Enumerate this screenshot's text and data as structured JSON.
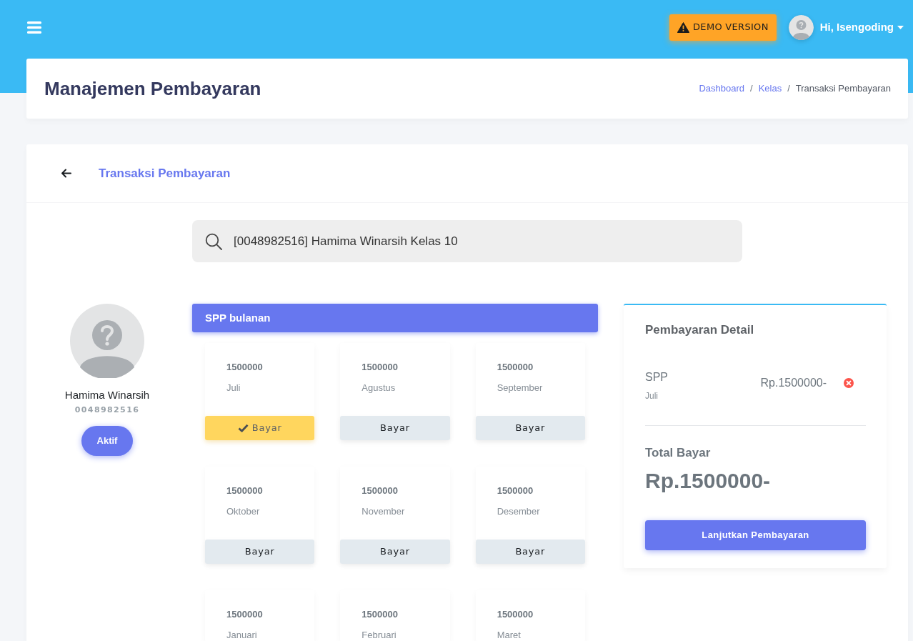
{
  "navbar": {
    "demo_badge": "DEMO VERSION",
    "user_greeting": "Hi, Isengoding"
  },
  "page_header": {
    "title": "Manajemen Pembayaran",
    "breadcrumb": [
      {
        "kind": "link",
        "text": "Dashboard"
      },
      {
        "kind": "separator",
        "text": "/"
      },
      {
        "kind": "link",
        "text": "Kelas"
      },
      {
        "kind": "separator",
        "text": "/"
      },
      {
        "kind": "current",
        "text": "Transaksi Pembayaran"
      }
    ]
  },
  "card": {
    "title": "Transaksi Pembayaran"
  },
  "search": {
    "value": "[0048982516] Hamima Winarsih Kelas 10"
  },
  "student": {
    "name": "Hamima Winarsih",
    "nis": "0048982516",
    "status": "Aktif"
  },
  "spp": {
    "title": "SPP bulanan",
    "months": [
      {
        "amount": "1500000",
        "month": "Juli",
        "button": "Bayar",
        "selected": true
      },
      {
        "amount": "1500000",
        "month": "Agustus",
        "button": "Bayar",
        "selected": false
      },
      {
        "amount": "1500000",
        "month": "September",
        "button": "Bayar",
        "selected": false
      },
      {
        "amount": "1500000",
        "month": "Oktober",
        "button": "Bayar",
        "selected": false
      },
      {
        "amount": "1500000",
        "month": "November",
        "button": "Bayar",
        "selected": false
      },
      {
        "amount": "1500000",
        "month": "Desember",
        "button": "Bayar",
        "selected": false
      },
      {
        "amount": "1500000",
        "month": "Januari"
      },
      {
        "amount": "1500000",
        "month": "Februari"
      },
      {
        "amount": "1500000",
        "month": "Maret"
      }
    ]
  },
  "detail": {
    "title": "Pembayaran Detail",
    "items": [
      {
        "name": "SPP",
        "month": "Juli",
        "amount": "Rp.1500000-"
      }
    ],
    "total_label": "Total Bayar",
    "total": "Rp.1500000-",
    "button": "Lanjutkan Pembayaran"
  }
}
